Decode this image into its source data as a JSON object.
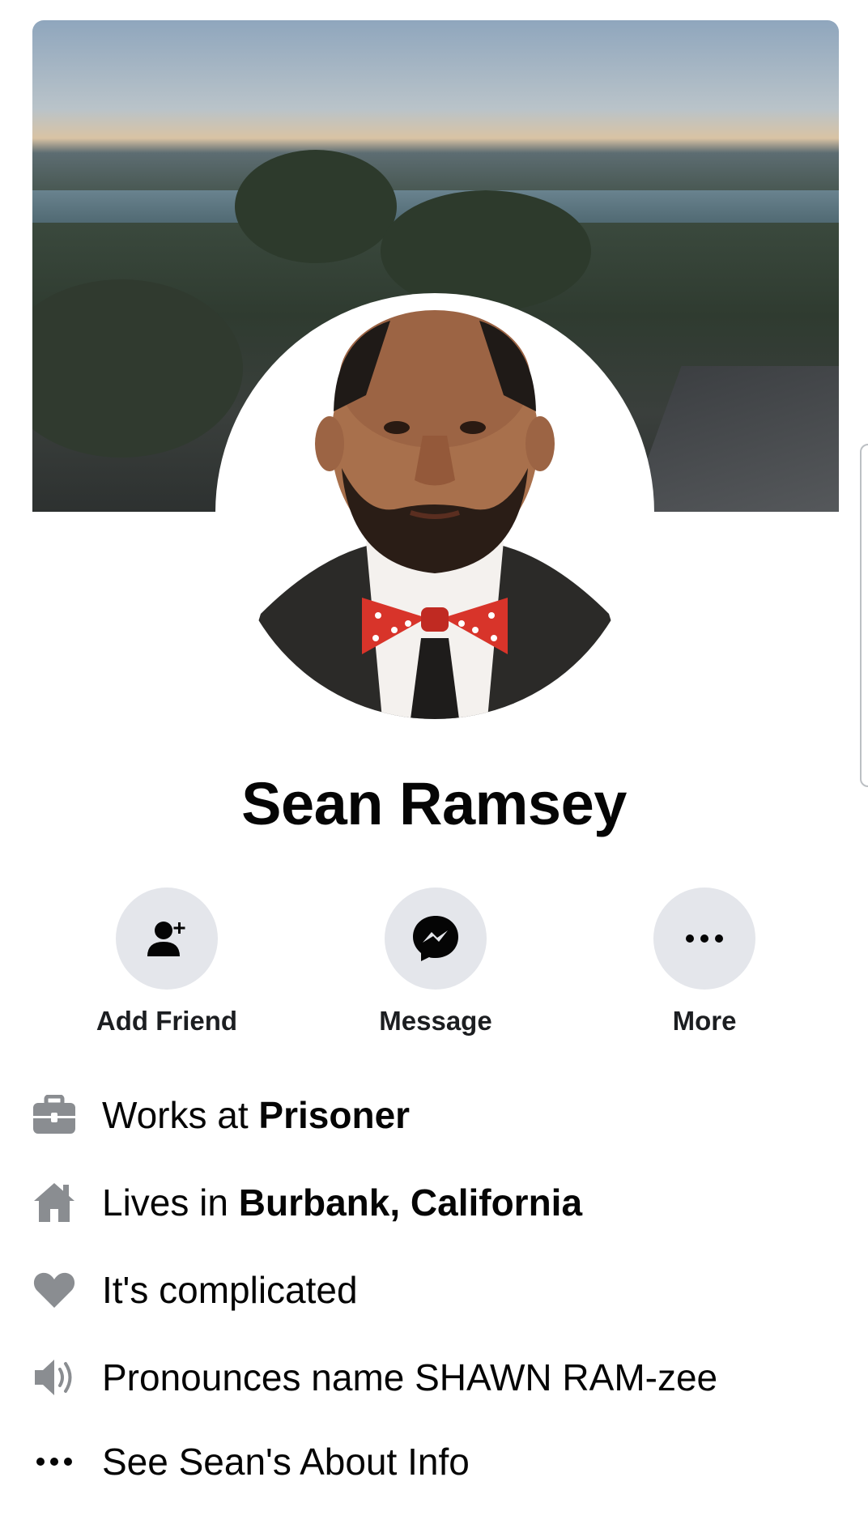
{
  "profile": {
    "name": "Sean Ramsey"
  },
  "actions": [
    {
      "label": "Add Friend",
      "icon": "add-friend-icon"
    },
    {
      "label": "Message",
      "icon": "messenger-icon"
    },
    {
      "label": "More",
      "icon": "more-icon"
    }
  ],
  "intro": {
    "work": {
      "prefix": "Works at ",
      "value": "Prisoner",
      "icon": "briefcase-icon"
    },
    "home": {
      "prefix": "Lives in ",
      "value": "Burbank, California",
      "icon": "home-icon"
    },
    "relationship": {
      "text": "It's complicated",
      "icon": "heart-icon"
    },
    "pronunciation": {
      "text": "Pronounces name SHAWN RAM-zee",
      "icon": "speaker-icon"
    },
    "about": {
      "text": "See Sean's About Info",
      "icon": "more-icon"
    }
  },
  "colors": {
    "icon_gray": "#8a8d91",
    "button_bg": "#e4e6eb",
    "text": "#050505"
  }
}
